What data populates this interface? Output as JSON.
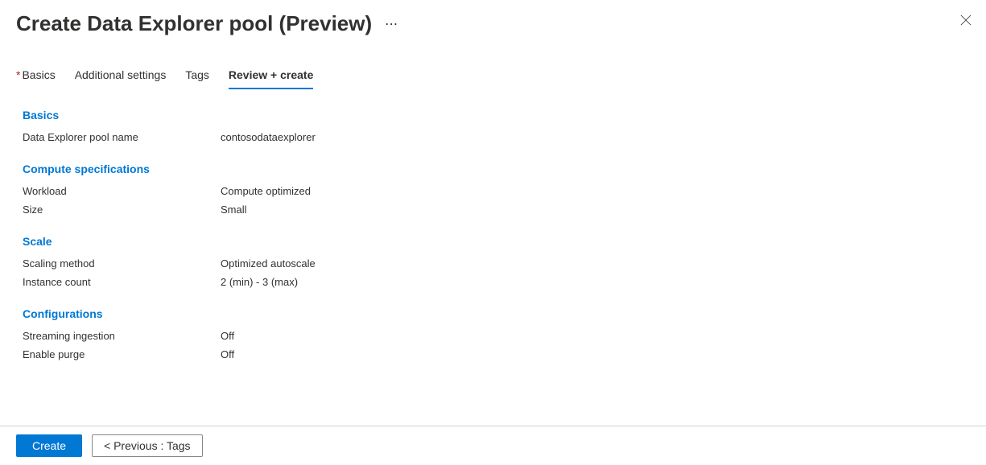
{
  "header": {
    "title": "Create Data Explorer pool (Preview)"
  },
  "tabs": {
    "basics": "Basics",
    "additional": "Additional settings",
    "tags": "Tags",
    "review": "Review + create"
  },
  "sections": {
    "basics": {
      "title": "Basics",
      "pool_name_label": "Data Explorer pool name",
      "pool_name_value": "contosodataexplorer"
    },
    "compute": {
      "title": "Compute specifications",
      "workload_label": "Workload",
      "workload_value": "Compute optimized",
      "size_label": "Size",
      "size_value": "Small"
    },
    "scale": {
      "title": "Scale",
      "method_label": "Scaling method",
      "method_value": "Optimized autoscale",
      "count_label": "Instance count",
      "count_value": "2 (min) - 3 (max)"
    },
    "config": {
      "title": "Configurations",
      "streaming_label": "Streaming ingestion",
      "streaming_value": "Off",
      "purge_label": "Enable purge",
      "purge_value": "Off"
    }
  },
  "footer": {
    "create": "Create",
    "previous": "<  Previous : Tags"
  }
}
